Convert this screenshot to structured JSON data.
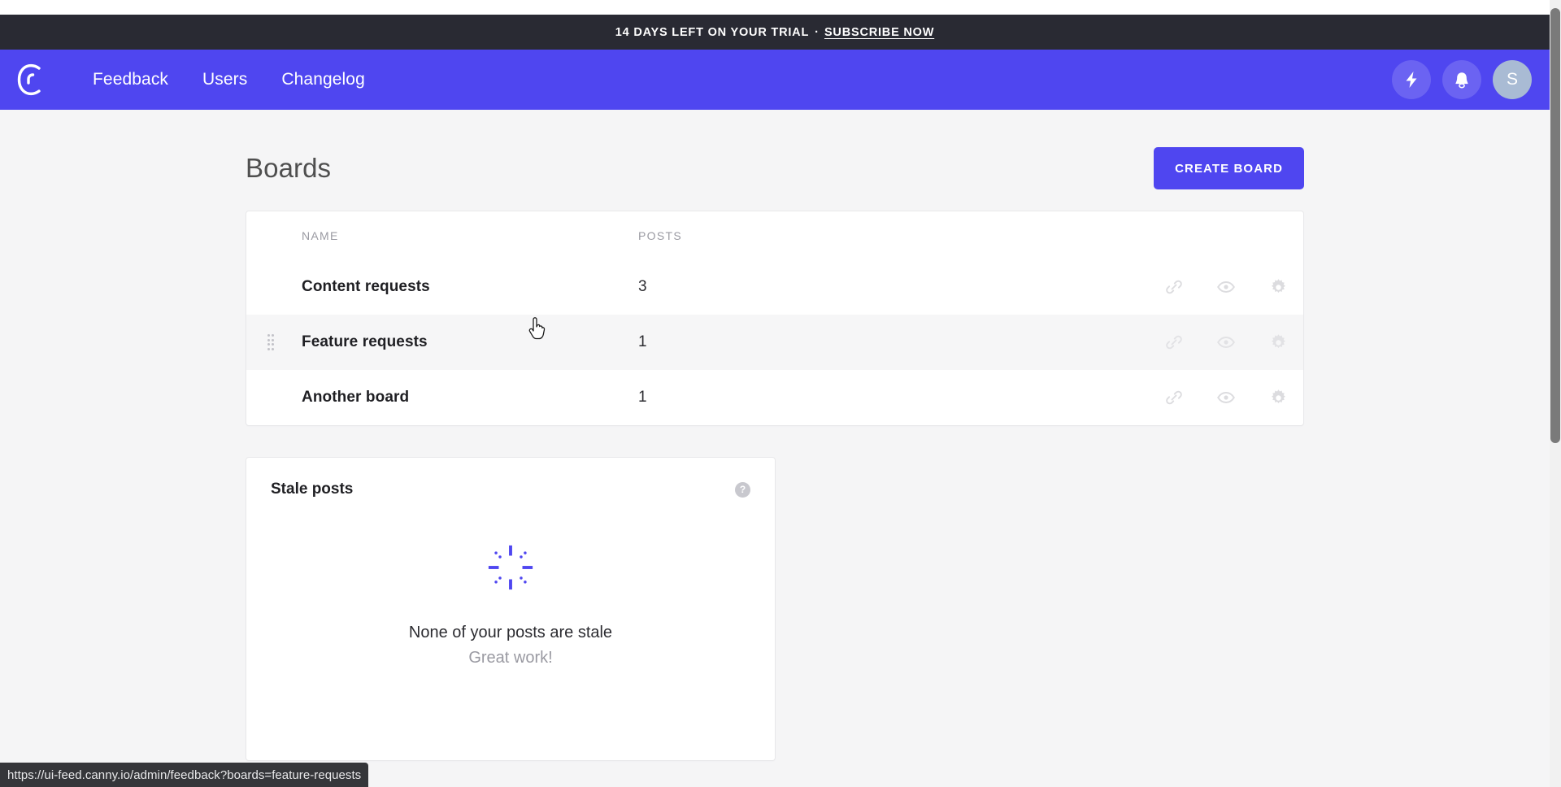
{
  "banner": {
    "trial_text": "14 DAYS LEFT ON YOUR TRIAL",
    "separator": "·",
    "subscribe_label": "SUBSCRIBE NOW"
  },
  "navbar": {
    "logo_name": "canny-logo",
    "links": [
      {
        "label": "Feedback"
      },
      {
        "label": "Users"
      },
      {
        "label": "Changelog"
      }
    ],
    "actions": [
      {
        "icon": "lightning-bolt-icon"
      },
      {
        "icon": "bell-icon"
      }
    ],
    "avatar_initial": "S",
    "background_color": "#4f46f0"
  },
  "page": {
    "title": "Boards",
    "create_board_label": "CREATE BOARD"
  },
  "boards_table": {
    "columns": [
      "NAME",
      "POSTS"
    ],
    "rows": [
      {
        "name": "Content requests",
        "posts": "3",
        "hovered": false
      },
      {
        "name": "Feature requests",
        "posts": "1",
        "hovered": true
      },
      {
        "name": "Another board",
        "posts": "1",
        "hovered": false
      }
    ],
    "row_actions": [
      "link-icon",
      "eye-icon",
      "gear-icon"
    ]
  },
  "stale_posts": {
    "title": "Stale posts",
    "help_label": "?",
    "empty_heading": "None of your posts are stale",
    "empty_sub": "Great work!",
    "spinner_color": "#4f46f0"
  },
  "status_bar": {
    "url": "https://ui-feed.canny.io/admin/feedback?boards=feature-requests"
  }
}
